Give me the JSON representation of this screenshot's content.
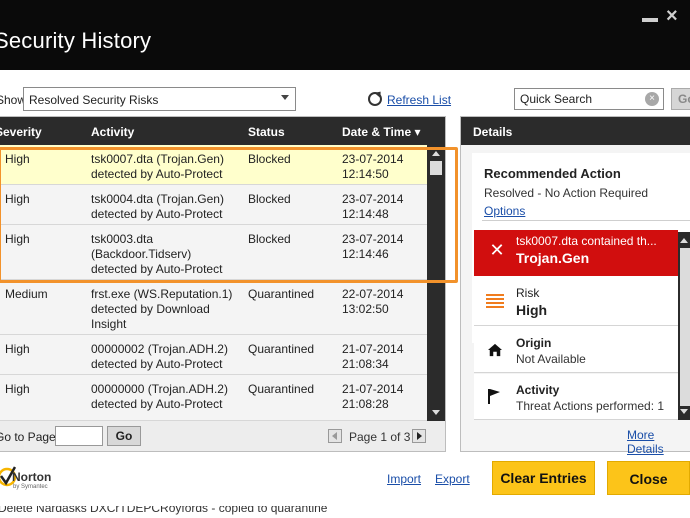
{
  "window": {
    "title": "Security History"
  },
  "filter": {
    "show_label": "Show",
    "selected": "Resolved Security Risks",
    "refresh_label": "Refresh List"
  },
  "search": {
    "placeholder": "Quick Search",
    "go_label": "Go"
  },
  "table": {
    "columns": [
      "Severity",
      "Activity",
      "Status",
      "Date & Time"
    ],
    "rows": [
      {
        "severity": "High",
        "activity": [
          "tsk0007.dta (Trojan.Gen)",
          "detected by Auto-Protect"
        ],
        "status": "Blocked",
        "date": "23-07-2014",
        "time": "12:14:50",
        "selected": true
      },
      {
        "severity": "High",
        "activity": [
          "tsk0004.dta (Trojan.Gen)",
          "detected by Auto-Protect"
        ],
        "status": "Blocked",
        "date": "23-07-2014",
        "time": "12:14:48"
      },
      {
        "severity": "High",
        "activity": [
          "tsk0003.dta",
          "(Backdoor.Tidserv)",
          "detected by Auto-Protect"
        ],
        "status": "Blocked",
        "date": "23-07-2014",
        "time": "12:14:46"
      },
      {
        "severity": "Medium",
        "activity": [
          "frst.exe (WS.Reputation.1)",
          "detected by Download",
          "Insight"
        ],
        "status": "Quarantined",
        "date": "22-07-2014",
        "time": "13:02:50"
      },
      {
        "severity": "High",
        "activity": [
          "00000002 (Trojan.ADH.2)",
          "detected by Auto-Protect"
        ],
        "status": "Quarantined",
        "date": "21-07-2014",
        "time": "21:08:34"
      },
      {
        "severity": "High",
        "activity": [
          "00000000 (Trojan.ADH.2)",
          "detected by Auto-Protect"
        ],
        "status": "Quarantined",
        "date": "21-07-2014",
        "time": "21:08:28"
      }
    ]
  },
  "pager": {
    "goto_label": "Go to Page:",
    "go_label": "Go",
    "page_text": "Page 1 of 3"
  },
  "details": {
    "header": "Details",
    "recommended_title": "Recommended Action",
    "recommended_sub": "Resolved - No Action Required",
    "options_label": "Options",
    "threat_line": "tsk0007.dta contained th...",
    "threat_name": "Trojan.Gen",
    "risk_label": "Risk",
    "risk_value": "High",
    "origin_label": "Origin",
    "origin_value": "Not Available",
    "activity_label": "Activity",
    "activity_value": "Threat Actions performed: 1",
    "more_details": "More Details"
  },
  "footer": {
    "brand": "Norton",
    "brand_sub": "by Symantec",
    "import_label": "Import",
    "export_label": "Export",
    "clear_label": "Clear Entries",
    "close_label": "Close",
    "bottom_text": "Delete Nardasks DXCrTDEPCRoyfords - copied to quarantine"
  },
  "colors": {
    "titlebar": "#0a0a0a",
    "highlight_row": "#ffffcc",
    "selection_outline": "#f2922b",
    "threat_red": "#d10e0e",
    "button_yellow": "#fcc419",
    "link_blue": "#1a4ea8"
  }
}
